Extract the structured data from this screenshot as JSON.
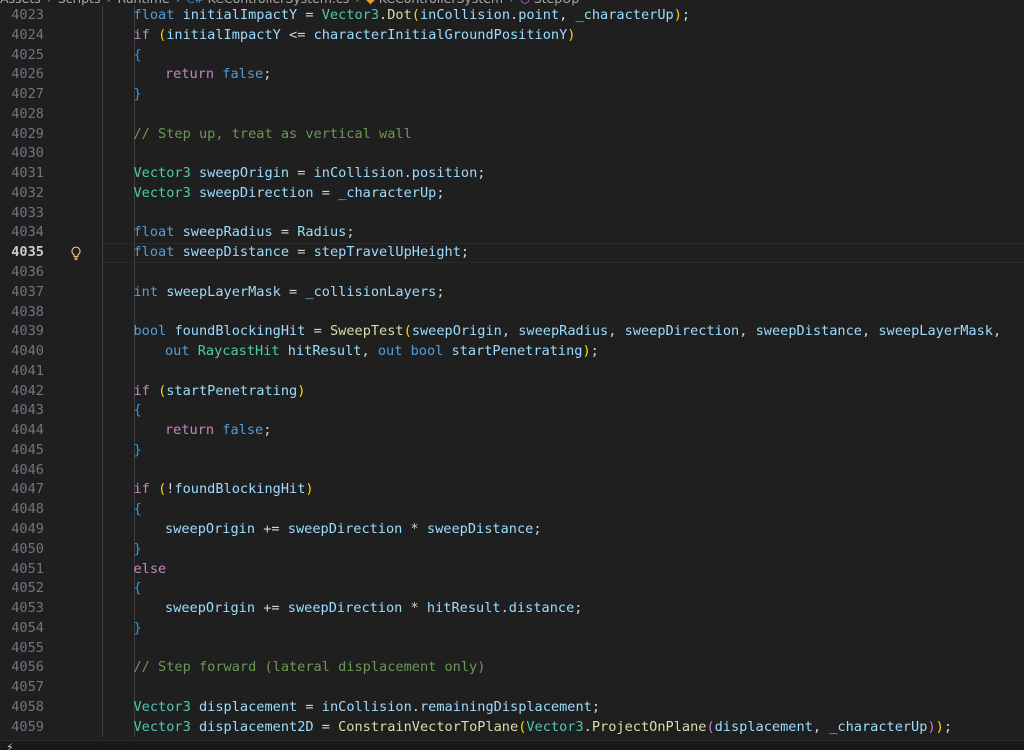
{
  "breadcrumb": [
    {
      "icon": "",
      "label": "Assets"
    },
    {
      "icon": "",
      "label": "Scripts"
    },
    {
      "icon": "",
      "label": "Runtime"
    },
    {
      "icon": "csharp-file-icon",
      "label": "KCControllerSystem.cs"
    },
    {
      "icon": "class-icon",
      "label": "KCControllerSystem"
    },
    {
      "icon": "method-icon",
      "label": "StepUp"
    }
  ],
  "editor": {
    "current_line": 4035,
    "lines": [
      {
        "n": "4023",
        "indent": 1,
        "tokens": [
          [
            "kw",
            "float"
          ],
          [
            "",
            ""
          ],
          [
            "var",
            " initialImpactY"
          ],
          [
            "op",
            " = "
          ],
          [
            "typ",
            "Vector3"
          ],
          [
            "op",
            "."
          ],
          [
            "fn",
            "Dot"
          ],
          [
            "p1",
            "("
          ],
          [
            "var",
            "inCollision"
          ],
          [
            "op",
            "."
          ],
          [
            "var",
            "point"
          ],
          [
            "op",
            ", "
          ],
          [
            "var",
            "_characterUp"
          ],
          [
            "p1",
            ")"
          ],
          [
            "op",
            ";"
          ]
        ]
      },
      {
        "n": "4024",
        "indent": 1,
        "tokens": [
          [
            "ctl",
            "if"
          ],
          [
            "op",
            " "
          ],
          [
            "p1",
            "("
          ],
          [
            "var",
            "initialImpactY"
          ],
          [
            "op",
            " <= "
          ],
          [
            "var",
            "characterInitialGroundPositionY"
          ],
          [
            "p1",
            ")"
          ]
        ]
      },
      {
        "n": "4025",
        "indent": 1,
        "tokens": [
          [
            "p3",
            "{"
          ]
        ]
      },
      {
        "n": "4026",
        "indent": 2,
        "tokens": [
          [
            "ctl",
            "return"
          ],
          [
            "op",
            " "
          ],
          [
            "kw",
            "false"
          ],
          [
            "op",
            ";"
          ]
        ]
      },
      {
        "n": "4027",
        "indent": 1,
        "tokens": [
          [
            "p3",
            "}"
          ]
        ]
      },
      {
        "n": "4028",
        "indent": 0,
        "tokens": []
      },
      {
        "n": "4029",
        "indent": 1,
        "tokens": [
          [
            "cmt",
            "// Step up, treat as vertical wall"
          ]
        ]
      },
      {
        "n": "4030",
        "indent": 0,
        "tokens": []
      },
      {
        "n": "4031",
        "indent": 1,
        "tokens": [
          [
            "typ",
            "Vector3"
          ],
          [
            "op",
            " "
          ],
          [
            "var",
            "sweepOrigin"
          ],
          [
            "op",
            " = "
          ],
          [
            "var",
            "inCollision"
          ],
          [
            "op",
            "."
          ],
          [
            "var",
            "position"
          ],
          [
            "op",
            ";"
          ]
        ]
      },
      {
        "n": "4032",
        "indent": 1,
        "tokens": [
          [
            "typ",
            "Vector3"
          ],
          [
            "op",
            " "
          ],
          [
            "var",
            "sweepDirection"
          ],
          [
            "op",
            " = "
          ],
          [
            "var",
            "_characterUp"
          ],
          [
            "op",
            ";"
          ]
        ]
      },
      {
        "n": "4033",
        "indent": 0,
        "tokens": []
      },
      {
        "n": "4034",
        "indent": 1,
        "tokens": [
          [
            "kw",
            "float"
          ],
          [
            "op",
            " "
          ],
          [
            "var",
            "sweepRadius"
          ],
          [
            "op",
            " = "
          ],
          [
            "var",
            "Radius"
          ],
          [
            "op",
            ";"
          ]
        ]
      },
      {
        "n": "4035",
        "indent": 1,
        "tokens": [
          [
            "kw",
            "float"
          ],
          [
            "op",
            " "
          ],
          [
            "var",
            "sweepDistance"
          ],
          [
            "op",
            " = "
          ],
          [
            "var",
            "stepTravelUpHeight"
          ],
          [
            "op",
            ";"
          ]
        ]
      },
      {
        "n": "4036",
        "indent": 0,
        "tokens": []
      },
      {
        "n": "4037",
        "indent": 1,
        "tokens": [
          [
            "kw",
            "int"
          ],
          [
            "op",
            " "
          ],
          [
            "var",
            "sweepLayerMask"
          ],
          [
            "op",
            " = "
          ],
          [
            "var",
            "_collisionLayers"
          ],
          [
            "op",
            ";"
          ]
        ]
      },
      {
        "n": "4038",
        "indent": 0,
        "tokens": []
      },
      {
        "n": "4039",
        "indent": 1,
        "tokens": [
          [
            "kw",
            "bool"
          ],
          [
            "op",
            " "
          ],
          [
            "var",
            "foundBlockingHit"
          ],
          [
            "op",
            " = "
          ],
          [
            "fn",
            "SweepTest"
          ],
          [
            "p1",
            "("
          ],
          [
            "var",
            "sweepOrigin"
          ],
          [
            "op",
            ", "
          ],
          [
            "var",
            "sweepRadius"
          ],
          [
            "op",
            ", "
          ],
          [
            "var",
            "sweepDirection"
          ],
          [
            "op",
            ", "
          ],
          [
            "var",
            "sweepDistance"
          ],
          [
            "op",
            ", "
          ],
          [
            "var",
            "sweepLayerMask"
          ],
          [
            "op",
            ","
          ]
        ]
      },
      {
        "n": "4040",
        "indent": 2,
        "tokens": [
          [
            "kw",
            "out"
          ],
          [
            "op",
            " "
          ],
          [
            "typ",
            "RaycastHit"
          ],
          [
            "op",
            " "
          ],
          [
            "var",
            "hitResult"
          ],
          [
            "op",
            ", "
          ],
          [
            "kw",
            "out"
          ],
          [
            "op",
            " "
          ],
          [
            "kw",
            "bool"
          ],
          [
            "op",
            " "
          ],
          [
            "var",
            "startPenetrating"
          ],
          [
            "p1",
            ")"
          ],
          [
            "op",
            ";"
          ]
        ]
      },
      {
        "n": "4041",
        "indent": 0,
        "tokens": []
      },
      {
        "n": "4042",
        "indent": 1,
        "tokens": [
          [
            "ctl",
            "if"
          ],
          [
            "op",
            " "
          ],
          [
            "p1",
            "("
          ],
          [
            "var",
            "startPenetrating"
          ],
          [
            "p1",
            ")"
          ]
        ]
      },
      {
        "n": "4043",
        "indent": 1,
        "tokens": [
          [
            "p3",
            "{"
          ]
        ]
      },
      {
        "n": "4044",
        "indent": 2,
        "tokens": [
          [
            "ctl",
            "return"
          ],
          [
            "op",
            " "
          ],
          [
            "kw",
            "false"
          ],
          [
            "op",
            ";"
          ]
        ]
      },
      {
        "n": "4045",
        "indent": 1,
        "tokens": [
          [
            "p3",
            "}"
          ]
        ]
      },
      {
        "n": "4046",
        "indent": 0,
        "tokens": []
      },
      {
        "n": "4047",
        "indent": 1,
        "tokens": [
          [
            "ctl",
            "if"
          ],
          [
            "op",
            " "
          ],
          [
            "p1",
            "("
          ],
          [
            "op",
            "!"
          ],
          [
            "var",
            "foundBlockingHit"
          ],
          [
            "p1",
            ")"
          ]
        ]
      },
      {
        "n": "4048",
        "indent": 1,
        "tokens": [
          [
            "p3",
            "{"
          ]
        ]
      },
      {
        "n": "4049",
        "indent": 2,
        "tokens": [
          [
            "var",
            "sweepOrigin"
          ],
          [
            "op",
            " += "
          ],
          [
            "var",
            "sweepDirection"
          ],
          [
            "op",
            " * "
          ],
          [
            "var",
            "sweepDistance"
          ],
          [
            "op",
            ";"
          ]
        ]
      },
      {
        "n": "4050",
        "indent": 1,
        "tokens": [
          [
            "p3",
            "}"
          ]
        ]
      },
      {
        "n": "4051",
        "indent": 1,
        "tokens": [
          [
            "ctl",
            "else"
          ]
        ]
      },
      {
        "n": "4052",
        "indent": 1,
        "tokens": [
          [
            "p3",
            "{"
          ]
        ]
      },
      {
        "n": "4053",
        "indent": 2,
        "tokens": [
          [
            "var",
            "sweepOrigin"
          ],
          [
            "op",
            " += "
          ],
          [
            "var",
            "sweepDirection"
          ],
          [
            "op",
            " * "
          ],
          [
            "var",
            "hitResult"
          ],
          [
            "op",
            "."
          ],
          [
            "var",
            "distance"
          ],
          [
            "op",
            ";"
          ]
        ]
      },
      {
        "n": "4054",
        "indent": 1,
        "tokens": [
          [
            "p3",
            "}"
          ]
        ]
      },
      {
        "n": "4055",
        "indent": 0,
        "tokens": []
      },
      {
        "n": "4056",
        "indent": 1,
        "tokens": [
          [
            "cmt",
            "// Step forward (lateral displacement only)"
          ]
        ]
      },
      {
        "n": "4057",
        "indent": 0,
        "tokens": []
      },
      {
        "n": "4058",
        "indent": 1,
        "tokens": [
          [
            "typ",
            "Vector3"
          ],
          [
            "op",
            " "
          ],
          [
            "var",
            "displacement"
          ],
          [
            "op",
            " = "
          ],
          [
            "var",
            "inCollision"
          ],
          [
            "op",
            "."
          ],
          [
            "var",
            "remainingDisplacement"
          ],
          [
            "op",
            ";"
          ]
        ]
      },
      {
        "n": "4059",
        "indent": 1,
        "tokens": [
          [
            "typ",
            "Vector3"
          ],
          [
            "op",
            " "
          ],
          [
            "var",
            "displacement2D"
          ],
          [
            "op",
            " = "
          ],
          [
            "fn",
            "ConstrainVectorToPlane"
          ],
          [
            "p1",
            "("
          ],
          [
            "typ",
            "Vector3"
          ],
          [
            "op",
            "."
          ],
          [
            "fn",
            "ProjectOnPlane"
          ],
          [
            "p2",
            "("
          ],
          [
            "var",
            "displacement"
          ],
          [
            "op",
            ", "
          ],
          [
            "var",
            "_characterUp"
          ],
          [
            "p2",
            ")"
          ],
          [
            "p1",
            ")"
          ],
          [
            "op",
            ";"
          ]
        ]
      }
    ]
  },
  "colors": {
    "background": "#1f1f1f",
    "keyword": "#569cd6",
    "control": "#c586c0",
    "type": "#4ec9b0",
    "variable": "#9cdcfe",
    "function": "#dcdcaa",
    "comment": "#6a9955",
    "bulb": "#e5c07b"
  }
}
